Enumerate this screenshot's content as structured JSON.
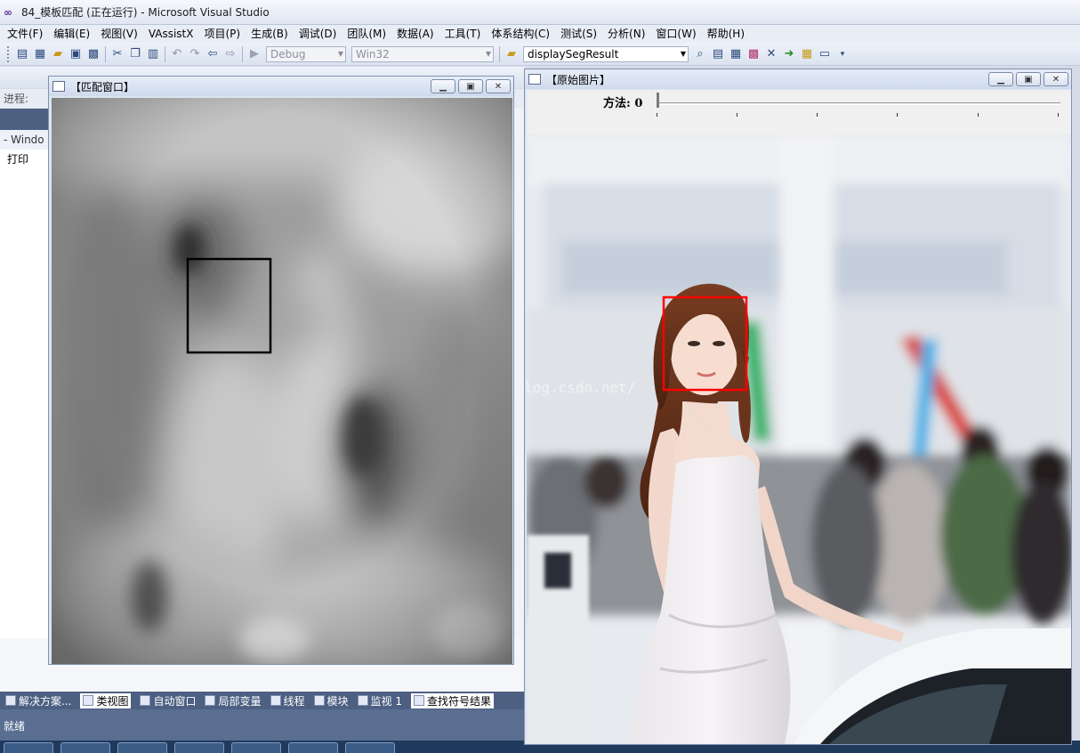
{
  "vs": {
    "title": "84_模板匹配 (正在运行) - Microsoft Visual Studio",
    "menu": [
      "文件(F)",
      "编辑(E)",
      "视图(V)",
      "VAssistX",
      "项目(P)",
      "生成(B)",
      "调试(D)",
      "团队(M)",
      "数据(A)",
      "工具(T)",
      "体系结构(C)",
      "测试(S)",
      "分析(N)",
      "窗口(W)",
      "帮助(H)"
    ],
    "toolbar": {
      "config": "Debug",
      "platform": "Win32",
      "function_combo": "displaySegResult"
    },
    "toolbar3_label": "进程:",
    "side_panel": {
      "row1": "- Windo",
      "row2": "打印"
    },
    "bottom_tabs": [
      "解决方案...",
      "类视图",
      "自动窗口",
      "局部变量",
      "线程",
      "模块",
      "监视 1",
      "查找符号结果"
    ],
    "status": "就绪"
  },
  "match_window": {
    "title": "【匹配窗口】",
    "match_box_color": "#000000"
  },
  "orig_window": {
    "title": "【原始图片】",
    "trackbar_label": "方法: 0",
    "trackbar_value": 0,
    "watermark": "http://blog.csdn.net/",
    "match_box_color": "#ff0000"
  }
}
